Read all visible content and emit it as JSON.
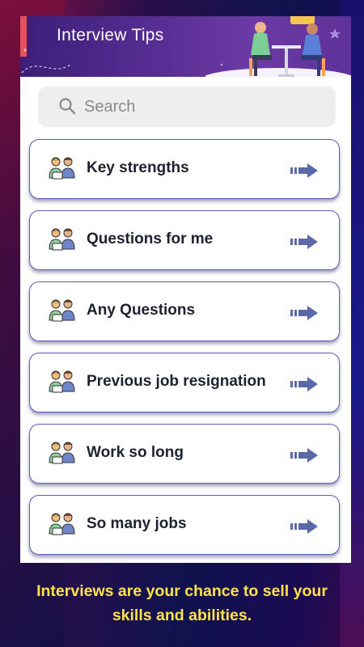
{
  "header": {
    "title": "Interview Tips"
  },
  "search": {
    "placeholder": "Search"
  },
  "items": [
    {
      "label": "Key strengths"
    },
    {
      "label": "Questions for me"
    },
    {
      "label": "Any Questions"
    },
    {
      "label": "Previous job resignation"
    },
    {
      "label": "Work so long"
    },
    {
      "label": "So many jobs"
    }
  ],
  "caption": {
    "line1": "Interviews are your chance to sell your",
    "line2": "skills and abilities."
  },
  "colors": {
    "header_bg": "#5a2f95",
    "accent": "#e8505b",
    "card_border": "#5a5ec0",
    "arrow": "#5b69a8",
    "caption": "#ffe24a"
  },
  "icons": {
    "search": "search-icon",
    "item": "interview-people-icon",
    "arrow": "arrow-right-icon"
  }
}
